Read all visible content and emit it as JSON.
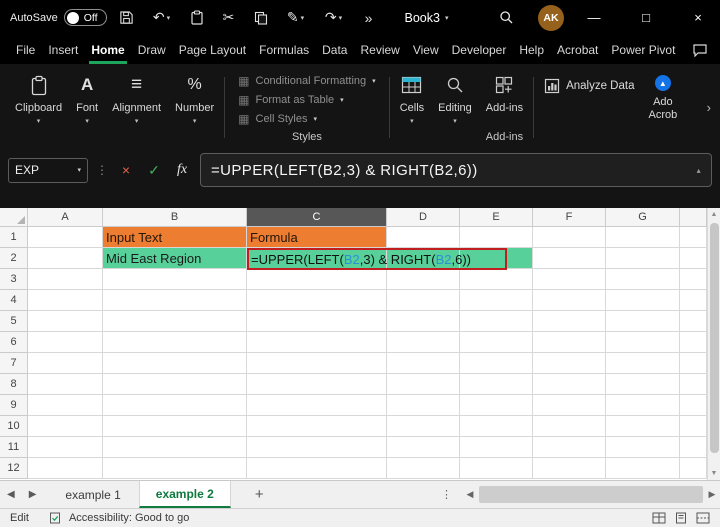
{
  "colors": {
    "accent_green": "#1EA55C",
    "tab_green": "#117B41",
    "orange_fill": "#ED7D31",
    "green_fill": "#57D09A",
    "reference_blue": "#2B91D6",
    "edit_border_red": "#C11F1F",
    "avatar_bg": "#96611C",
    "adobe_blue": "#1473E6"
  },
  "titlebar": {
    "autosave_label": "AutoSave",
    "autosave_state": "Off",
    "workbook_title": "Book3",
    "avatar_initials": "AK",
    "overflow_glyph": "»"
  },
  "menubar": {
    "items": [
      "File",
      "Insert",
      "Home",
      "Draw",
      "Page Layout",
      "Formulas",
      "Data",
      "Review",
      "View",
      "Developer",
      "Help",
      "Acrobat",
      "Power Pivot"
    ],
    "active_item": "Home"
  },
  "ribbon": {
    "clipboard_label": "Clipboard",
    "font_label": "Font",
    "alignment_label": "Alignment",
    "number_label": "Number",
    "styles_label": "Styles",
    "styles_buttons": [
      "Conditional Formatting",
      "Format as Table",
      "Cell Styles"
    ],
    "cells_label": "Cells",
    "editing_label": "Editing",
    "addins_button_label": "Add-ins",
    "addins_group_label": "Add-ins",
    "analyze_data_label": "Analyze Data",
    "acrobat_label_line1": "Ado",
    "acrobat_label_line2": "Acrob"
  },
  "formula_bar": {
    "name_box_value": "EXP",
    "cancel_glyph": "×",
    "enter_glyph": "✓",
    "fx_label": "fx",
    "formula": "=UPPER(LEFT(B2,3) &  RIGHT(B2,6))"
  },
  "grid": {
    "column_headers": [
      "A",
      "B",
      "C",
      "D",
      "E",
      "F",
      "G"
    ],
    "selected_column": "C",
    "row_headers": [
      "1",
      "2",
      "3",
      "4",
      "5",
      "6",
      "7",
      "8",
      "9",
      "10",
      "11",
      "12"
    ],
    "cells": {
      "B1": "Input Text",
      "C1": "Formula",
      "B2": "Mid East Region"
    },
    "fills": {
      "B1": "orange",
      "C1": "orange",
      "B2": "green",
      "C2": "green",
      "D2": "green",
      "E2": "green"
    },
    "c2_edit_segments": [
      {
        "text": "=UPPER(LEFT(",
        "color": "dark"
      },
      {
        "text": "B2",
        "color": "blue"
      },
      {
        "text": ",3) & RIGHT(",
        "color": "dark"
      },
      {
        "text": "B2",
        "color": "blue"
      },
      {
        "text": ",6))",
        "color": "dark"
      }
    ]
  },
  "sheet_tabs": {
    "tabs": [
      "example 1",
      "example 2"
    ],
    "active_tab": "example 2",
    "add_sheet_label": "+"
  },
  "status_bar": {
    "mode": "Edit",
    "accessibility_text": "Accessibility: Good to go"
  }
}
